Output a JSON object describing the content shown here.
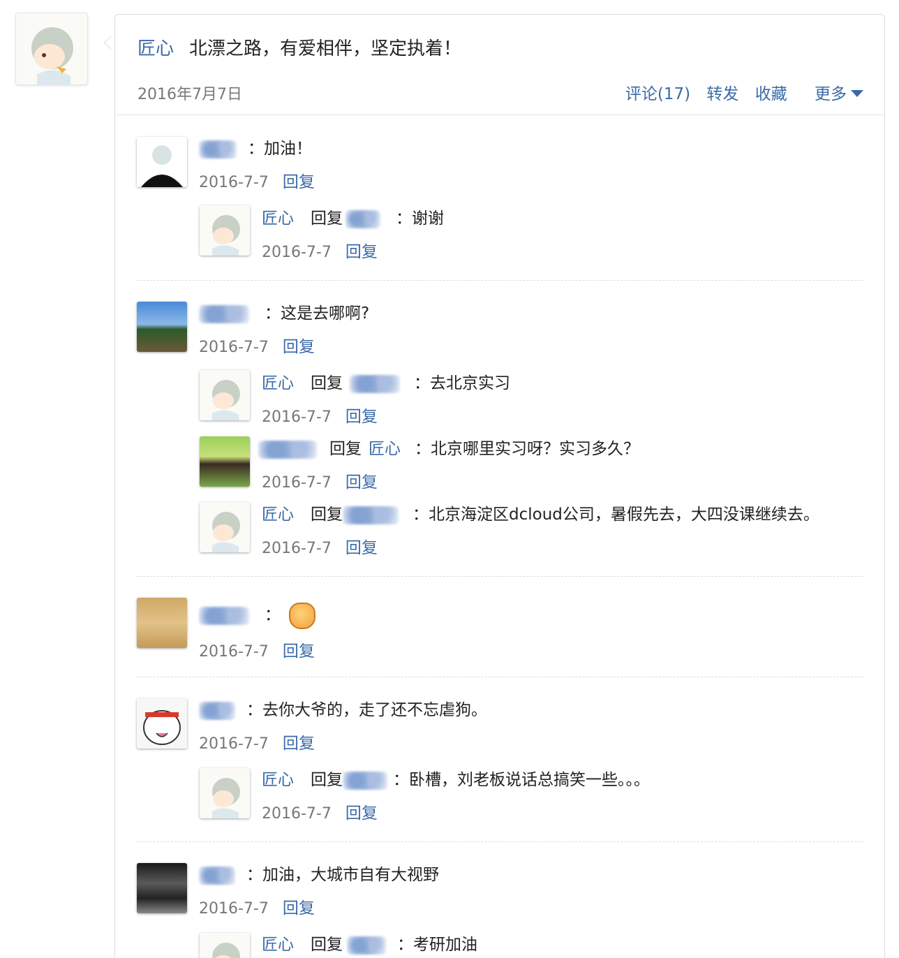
{
  "post": {
    "author": "匠心",
    "text": "北漂之路，有爱相伴，坚定执着！",
    "date": "2016年7月7日",
    "actions": {
      "comment": "评论(17)",
      "forward": "转发",
      "favorite": "收藏",
      "more": "更多"
    }
  },
  "labels": {
    "reply": "回复",
    "colon": "："
  },
  "comments": [
    {
      "text": "：加油！",
      "date": "2016-7-7",
      "replies": [
        {
          "author": "匠心",
          "text": "：谢谢",
          "date": "2016-7-7"
        }
      ]
    },
    {
      "text": "：这是去哪啊?",
      "date": "2016-7-7",
      "replies": [
        {
          "author": "匠心",
          "text": "：去北京实习",
          "date": "2016-7-7"
        },
        {
          "target": "匠心",
          "text": "：北京哪里实习呀？实习多久？",
          "date": "2016-7-7"
        },
        {
          "author": "匠心",
          "text": "：北京海淀区dcloud公司，暑假先去，大四没课继续去。",
          "date": "2016-7-7"
        }
      ]
    },
    {
      "text": "：",
      "date": "2016-7-7",
      "emoji": "fist-emoji-icon"
    },
    {
      "text": "：去你大爷的，走了还不忘虐狗。",
      "date": "2016-7-7",
      "replies": [
        {
          "author": "匠心",
          "text": "：卧槽，刘老板说话总搞笑一些。。。",
          "date": "2016-7-7"
        }
      ]
    },
    {
      "text": "：加油，大城市自有大视野",
      "date": "2016-7-7",
      "replies": [
        {
          "author": "匠心",
          "text": "：考研加油"
        }
      ]
    }
  ],
  "colors": {
    "link": "#3b6aa8",
    "text": "#222222",
    "muted": "#777777"
  }
}
